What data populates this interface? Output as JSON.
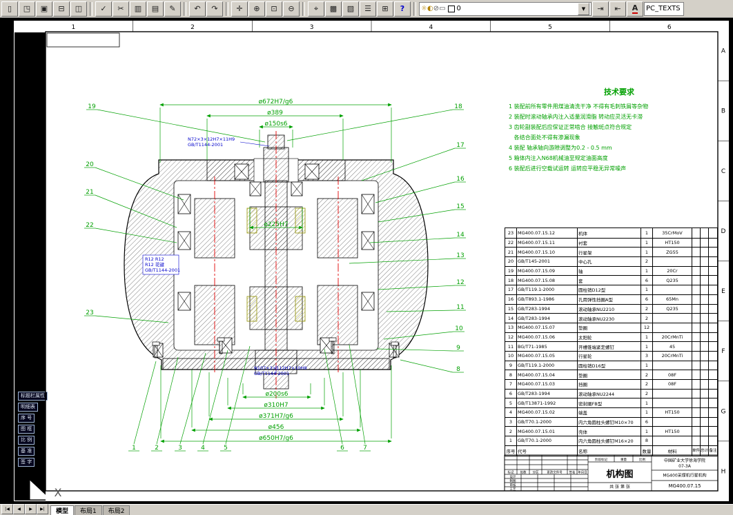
{
  "toolbar": {
    "buttons": [
      {
        "name": "new-button",
        "glyph": "▯"
      },
      {
        "name": "open-button",
        "glyph": "◳"
      },
      {
        "name": "save-button",
        "glyph": "▣"
      },
      {
        "name": "print-button",
        "glyph": "⊟"
      },
      {
        "name": "plot-preview-button",
        "glyph": "◫"
      },
      {
        "sep": true
      },
      {
        "name": "spelling-button",
        "glyph": "✓"
      },
      {
        "name": "cut-button",
        "glyph": "✂"
      },
      {
        "name": "copy-button",
        "glyph": "▥"
      },
      {
        "name": "paste-button",
        "glyph": "▤"
      },
      {
        "name": "match-properties-button",
        "glyph": "✎"
      },
      {
        "sep": true
      },
      {
        "name": "undo-button",
        "glyph": "↶"
      },
      {
        "name": "redo-button",
        "glyph": "↷"
      },
      {
        "sep": true
      },
      {
        "name": "pan-button",
        "glyph": "✛"
      },
      {
        "name": "zoom-realtime-button",
        "glyph": "⊕"
      },
      {
        "name": "zoom-window-button",
        "glyph": "⊡"
      },
      {
        "name": "zoom-previous-button",
        "glyph": "⊖"
      },
      {
        "sep": true
      },
      {
        "name": "ucs-button",
        "glyph": "⌖"
      },
      {
        "name": "grid-button",
        "glyph": "▩"
      },
      {
        "name": "layers-dialog-button",
        "glyph": "▧"
      },
      {
        "name": "properties-button",
        "glyph": "☰"
      },
      {
        "name": "calculator-button",
        "glyph": "⊞"
      },
      {
        "name": "help-button",
        "glyph": "?"
      },
      {
        "sep": true
      }
    ],
    "layer_controls": {
      "status_icons": [
        "☼",
        "◐",
        "⊘",
        "▭"
      ],
      "current_layer": "0"
    },
    "right_buttons": [
      {
        "name": "make-object-layer-button",
        "glyph": "⇥"
      },
      {
        "name": "layer-previous-button",
        "glyph": "⇤"
      },
      {
        "name": "text-style-button",
        "glyph": "A"
      }
    ],
    "text_style": "PC_TEXTS"
  },
  "sheet": {
    "columns": [
      "1",
      "2",
      "3",
      "4",
      "5",
      "6"
    ],
    "rows": [
      "A",
      "B",
      "C",
      "D",
      "E",
      "F",
      "G",
      "H"
    ]
  },
  "drawing": {
    "dims_top": [
      "ø672H7/g6",
      "ø389",
      "ø150s6"
    ],
    "dim_mid": "ø225H7",
    "dims_bottom": [
      "ø200s6",
      "ø310H7",
      "ø371H7/g6",
      "ø456",
      "ø650H7/g6"
    ],
    "balloons_left": [
      "19",
      "20",
      "21",
      "22",
      "23"
    ],
    "balloons_right": [
      "18",
      "17",
      "16",
      "15",
      "14",
      "13",
      "12",
      "11",
      "10",
      "9",
      "8"
    ],
    "balloons_bottom": [
      "1",
      "2",
      "3",
      "4",
      "5",
      "6",
      "7"
    ],
    "blue_notes": [
      {
        "lines": [
          "N72×3×12H7×11H9",
          "GB/T1144-2001"
        ]
      },
      {
        "lines": [
          "R12  R12",
          "R12 花键",
          "GB/T1144-2001"
        ]
      },
      {
        "lines": [
          "N107×3×112H7×10H9",
          "GB/T1144-2001"
        ]
      }
    ],
    "ucs_label": "X"
  },
  "tech": {
    "title": "技术要求",
    "lines": [
      "1 装配前所有零件用煤油清洗干净 不得有毛刺铁屑等杂物",
      "2 装配时滚动轴承内注入适量润滑脂 转动应灵活无卡滞",
      "3 齿轮副装配后应保证正常啮合 接触斑点符合规定",
      "   各结合面处不得有渗漏现象",
      "4 装配 轴承轴向游隙调整为0.2 - 0.5 mm",
      "5 箱体内注入N68机械油至规定油面高度",
      "6 装配后进行空载试运转 运转应平稳无异常噪声"
    ]
  },
  "bom": {
    "headers": [
      "序号",
      "代号",
      "名称",
      "数量",
      "材料",
      "单件",
      "总计",
      "备注"
    ],
    "rows": [
      {
        "no": "23",
        "code": "MG400.07.15.12",
        "name": "机体",
        "qty": "1",
        "mat": "35CrMoV"
      },
      {
        "no": "22",
        "code": "MG400.07.15.11",
        "name": "衬套",
        "qty": "1",
        "mat": "HT150"
      },
      {
        "no": "21",
        "code": "MG400.07.15.10",
        "name": "行星架",
        "qty": "1",
        "mat": "ZG55"
      },
      {
        "no": "20",
        "code": "GB/T145-2001",
        "name": "中心孔",
        "qty": "2",
        "mat": ""
      },
      {
        "no": "19",
        "code": "MG400.07.15.09",
        "name": "轴",
        "qty": "1",
        "mat": "20Cr"
      },
      {
        "no": "18",
        "code": "MG400.07.15.08",
        "name": "套",
        "qty": "6",
        "mat": "Q235"
      },
      {
        "no": "17",
        "code": "GB/T119.1-2000",
        "name": "圆柱销D12型",
        "qty": "1",
        "mat": ""
      },
      {
        "no": "16",
        "code": "GB/T893.1-1986",
        "name": "孔用弹性挡圈A型",
        "qty": "6",
        "mat": "65Mn"
      },
      {
        "no": "15",
        "code": "GB/T283-1994",
        "name": "滚动轴承NU2210",
        "qty": "2",
        "mat": "Q235"
      },
      {
        "no": "14",
        "code": "GB/T283-1994",
        "name": "滚动轴承NU2230",
        "qty": "2",
        "mat": ""
      },
      {
        "no": "13",
        "code": "MG400.07.15.07",
        "name": "垫圈",
        "qty": "12",
        "mat": ""
      },
      {
        "no": "12",
        "code": "MG400.07.15.06",
        "name": "太阳轮",
        "qty": "1",
        "mat": "20CrMnTi"
      },
      {
        "no": "11",
        "code": "BG/T71-1985",
        "name": "开槽锥端紧定螺钉",
        "qty": "1",
        "mat": "45"
      },
      {
        "no": "10",
        "code": "MG400.07.15.05",
        "name": "行星轮",
        "qty": "3",
        "mat": "20CrMnTi"
      },
      {
        "no": "9",
        "code": "GB/T119.1-2000",
        "name": "圆柱销D16型",
        "qty": "1",
        "mat": ""
      },
      {
        "no": "8",
        "code": "MG400.07.15.04",
        "name": "垫圈",
        "qty": "2",
        "mat": "08F"
      },
      {
        "no": "7",
        "code": "MG400.07.15.03",
        "name": "挡圈",
        "qty": "2",
        "mat": "08F"
      },
      {
        "no": "6",
        "code": "GB/T283-1994",
        "name": "滚动轴承NU2244",
        "qty": "2",
        "mat": ""
      },
      {
        "no": "5",
        "code": "GB/T13871-1992",
        "name": "密封圈FB型",
        "qty": "1",
        "mat": ""
      },
      {
        "no": "4",
        "code": "MG400.07.15.02",
        "name": "端盖",
        "qty": "1",
        "mat": "HT150"
      },
      {
        "no": "3",
        "code": "GB/T70.1-2000",
        "name": "内六角圆柱头螺钉M10×70",
        "qty": "6",
        "mat": ""
      },
      {
        "no": "2",
        "code": "MG400.07.15.01",
        "name": "壳体",
        "qty": "1",
        "mat": "HT150"
      },
      {
        "no": "1",
        "code": "GB/T70.1-2000",
        "name": "内六角圆柱头螺钉M16×20",
        "qty": "8",
        "mat": ""
      }
    ]
  },
  "title_block": {
    "title": "机构图",
    "org_line1": "中国矿业大学徐海学院",
    "org_line2": "07-3A",
    "project": "MG400采煤机行星机构",
    "drawing_no": "MG400.07.15",
    "rev_headers": [
      "标记",
      "处数",
      "分区",
      "更改文件号",
      "签名",
      "年月日"
    ],
    "sign_labels": [
      "设计",
      "制图",
      "审核",
      "工艺"
    ],
    "mid_headers": [
      "阶段标记",
      "重量",
      "比例"
    ],
    "sheet_info": "共 张 第 张"
  },
  "palette": {
    "items": [
      "标题栏属性",
      "明细表",
      "序 号",
      "图 框",
      "比 例",
      "基 准",
      "签 字"
    ]
  },
  "statusbar": {
    "nav": [
      "|◀",
      "◀",
      "▶",
      "▶|"
    ],
    "tabs": [
      "模型",
      "布局1",
      "布局2"
    ],
    "active_tab": "模型"
  }
}
